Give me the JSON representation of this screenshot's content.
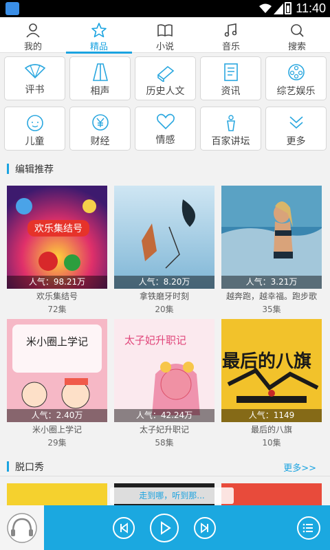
{
  "status_bar": {
    "time": "11:40"
  },
  "tabs": [
    {
      "label": "我的",
      "icon": "user-icon"
    },
    {
      "label": "精品",
      "icon": "star-icon",
      "active": true
    },
    {
      "label": "小说",
      "icon": "book-icon"
    },
    {
      "label": "音乐",
      "icon": "music-note-icon"
    },
    {
      "label": "搜索",
      "icon": "search-icon"
    }
  ],
  "categories": [
    {
      "label": "评书",
      "icon": "fan-icon"
    },
    {
      "label": "相声",
      "icon": "gown-icon"
    },
    {
      "label": "历史人文",
      "icon": "book-stack-icon"
    },
    {
      "label": "资讯",
      "icon": "news-icon"
    },
    {
      "label": "综艺娱乐",
      "icon": "film-reel-icon"
    },
    {
      "label": "儿童",
      "icon": "child-face-icon"
    },
    {
      "label": "财经",
      "icon": "yuan-icon"
    },
    {
      "label": "情感",
      "icon": "heart-icon"
    },
    {
      "label": "百家讲坛",
      "icon": "podium-icon"
    },
    {
      "label": "更多",
      "icon": "double-chevron-down-icon"
    }
  ],
  "editor_picks": {
    "title": "编辑推荐",
    "items": [
      {
        "popularity": "人气：98.21万",
        "title": "欢乐集结号",
        "count": "72集",
        "cover_text": "欢乐集结号"
      },
      {
        "popularity": "人气：8.20万",
        "title": "拿铁磨牙时刻",
        "count": "20集"
      },
      {
        "popularity": "人气：3.21万",
        "title": "越奔跑，越幸福。跑步歌",
        "count": "35集"
      },
      {
        "popularity": "人气：2.40万",
        "title": "米小圈上学记",
        "count": "29集",
        "cover_text": "米小圈上学记"
      },
      {
        "popularity": "人气：42.24万",
        "title": "太子妃升职记",
        "count": "58集",
        "cover_text": "太子妃升职记"
      },
      {
        "popularity": "人气：1149",
        "title": "最后的八旗",
        "count": "10集",
        "cover_text": "最后的八旗"
      }
    ]
  },
  "talk_show": {
    "title": "脱口秀",
    "more": "更多>>"
  },
  "player": {
    "now_playing": "走到哪，听到那..."
  },
  "colors": {
    "accent": "#1aa3e0",
    "player_bar": "#1ba8e0"
  }
}
